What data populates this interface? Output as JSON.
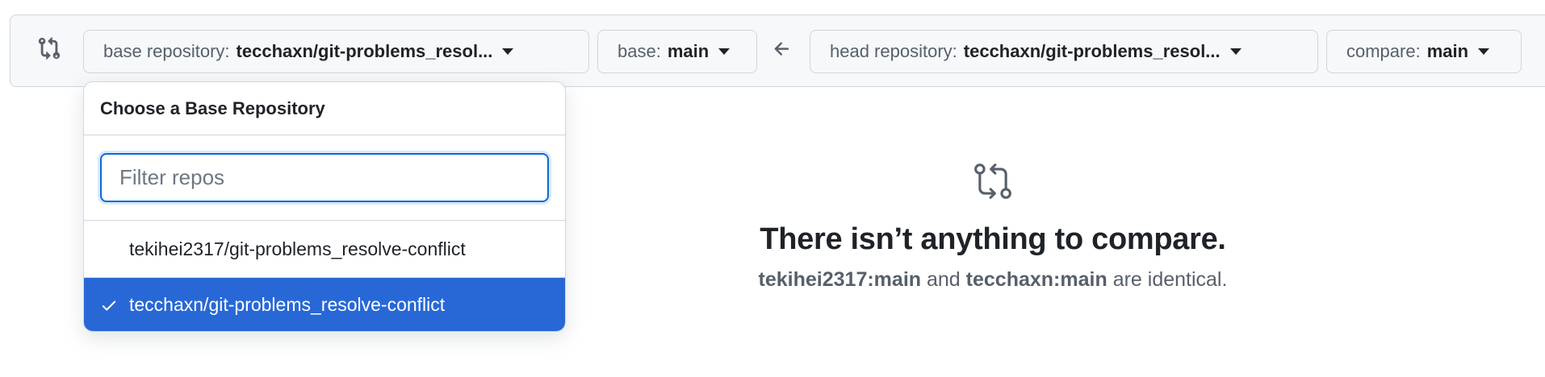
{
  "range_bar": {
    "base_repository": {
      "prefix": "base repository:",
      "value": "tecchaxn/git-problems_resol..."
    },
    "base_branch": {
      "prefix": "base:",
      "value": "main"
    },
    "head_repository": {
      "prefix": "head repository:",
      "value": "tecchaxn/git-problems_resol..."
    },
    "compare_branch": {
      "prefix": "compare:",
      "value": "main"
    }
  },
  "dropdown": {
    "title": "Choose a Base Repository",
    "filter": {
      "placeholder": "Filter repos",
      "value": ""
    },
    "items": [
      {
        "label": "tekihei2317/git-problems_resolve-conflict",
        "selected": false
      },
      {
        "label": "tecchaxn/git-problems_resolve-conflict",
        "selected": true
      }
    ]
  },
  "blankslate": {
    "heading": "There isn’t anything to compare.",
    "base_ref": "tekihei2317:main",
    "connector": "and",
    "head_ref": "tecchaxn:main",
    "suffix": "are identical."
  },
  "colors": {
    "accent": "#0969da",
    "selected_bg": "#2868d6",
    "border": "#d0d7de",
    "muted_text": "#57606a"
  },
  "icons": [
    "git-compare-icon",
    "caret-down-icon",
    "arrow-left-icon",
    "check-icon"
  ]
}
